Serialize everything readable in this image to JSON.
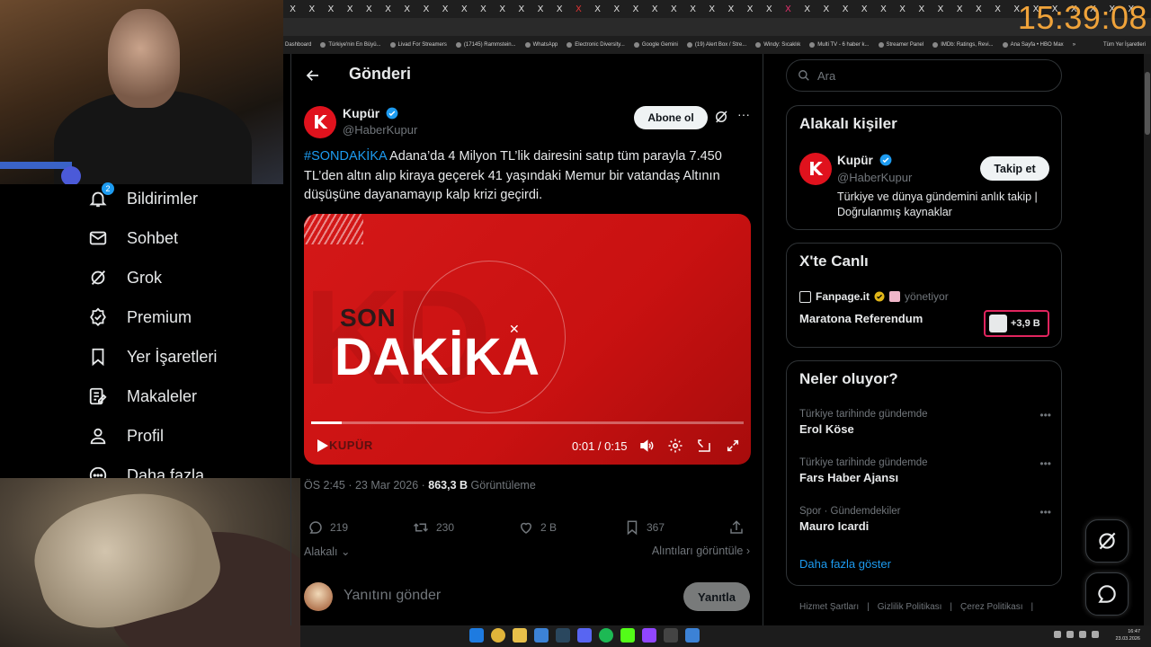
{
  "clock": "15:39:08",
  "browser": {
    "tabs": [
      "X",
      "X",
      "X",
      "X",
      "X",
      "X",
      "X",
      "X",
      "X",
      "X",
      "X",
      "X",
      "X",
      "X",
      "X",
      "X",
      "X",
      "X",
      "X",
      "X",
      "X",
      "X",
      "X",
      "X",
      "X",
      "X",
      "X",
      "X",
      "X",
      "X",
      "X",
      "X",
      "X",
      "X",
      "X",
      "X",
      "X",
      "X",
      "X",
      "X",
      "X",
      "X",
      "X",
      "X",
      "X"
    ],
    "bookmarks": [
      "Dashboard",
      "Türkiye'nin En Büyü...",
      "Livad For Streamers",
      "(17145) Rammstein...",
      "WhatsApp",
      "Electronic Diversity...",
      "Google Gemini",
      "(19) Alert Box / Stre...",
      "Windy: Sıcaklık",
      "Multi TV - 6 haber k...",
      "Streamer Panel",
      "IMDb: Ratings, Revi...",
      "Ana Sayfa • HBO Max"
    ],
    "bookmarks_overflow": "»",
    "all_bookmarks": "Tüm Yer İşaretleri"
  },
  "nav": {
    "notifications_badge": "2",
    "items": [
      {
        "label": "Bildirimler",
        "icon": "bell-icon"
      },
      {
        "label": "Sohbet",
        "icon": "mail-icon"
      },
      {
        "label": "Grok",
        "icon": "grok-icon"
      },
      {
        "label": "Premium",
        "icon": "premium-icon"
      },
      {
        "label": "Yer İşaretleri",
        "icon": "bookmark-icon"
      },
      {
        "label": "Makaleler",
        "icon": "article-icon"
      },
      {
        "label": "Profil",
        "icon": "profile-icon"
      },
      {
        "label": "Daha fazla",
        "icon": "more-circle-icon"
      }
    ]
  },
  "header": {
    "title": "Gönderi"
  },
  "post": {
    "author_name": "Kupür",
    "author_handle": "@HaberKupur",
    "avatar_letter": "K",
    "follow_label": "Abone ol",
    "more": "···",
    "hashtag": "#SONDAKİKA",
    "text": " Adana’da 4 Milyon TL’lik dairesini satıp tüm parayla 7.450 TL’den altın alıp kiraya geçerek 41 yaşındaki Memur bir vatandaş Altının düşüşüne dayanamayıp kalp krizi geçirdi.",
    "media": {
      "son": "SON",
      "dakika": "DAKİKA",
      "logo": "KUPÜR",
      "time": "0:01 / 0:15",
      "progress": 0.07
    },
    "meta_time": "ÖS 2:45 · 23 Mar 2026 · ",
    "views_count": "863,3 B",
    "views_label": " Görüntüleme",
    "stats": {
      "replies": "219",
      "reposts": "230",
      "likes": "2 B",
      "bookmarks": "367"
    },
    "related": "Alakalı",
    "quotes": "Alıntıları görüntüle",
    "reply_placeholder": "Yanıtını gönder",
    "reply_button": "Yanıtla"
  },
  "sidebar": {
    "search_placeholder": "Ara",
    "related_people": {
      "title": "Alakalı kişiler",
      "name": "Kupür",
      "handle": "@HaberKupur",
      "avatar_letter": "K",
      "follow": "Takip et",
      "bio": "Türkiye ve dünya gündemini anlık takip | Doğrulanmış kaynaklar"
    },
    "live": {
      "title": "X'te Canlı",
      "host": "Fanpage.it",
      "hosting": "yönetiyor",
      "stream_title": "Maratona Referendum",
      "listeners": "+3,9 B"
    },
    "trends": {
      "title": "Neler oluyor?",
      "items": [
        {
          "context": "Türkiye tarihinde gündemde",
          "name": "Erol Köse"
        },
        {
          "context": "Türkiye tarihinde gündemde",
          "name": "Fars Haber Ajansı"
        },
        {
          "context": "Spor · Gündemdekiler",
          "name": "Mauro Icardi"
        }
      ],
      "show_more": "Daha fazla göster"
    },
    "footer": [
      "Hizmet Şartları",
      "|",
      "Gizlilik Politikası",
      "|",
      "Çerez Politikası",
      "|"
    ]
  },
  "taskbar": {
    "time": "16:47",
    "date": "23.03.2026"
  },
  "colors": {
    "accent": "#1d9bf0",
    "clock": "#f0a33a",
    "brand_red": "#e0121d",
    "live_pill": "#e0245e"
  }
}
